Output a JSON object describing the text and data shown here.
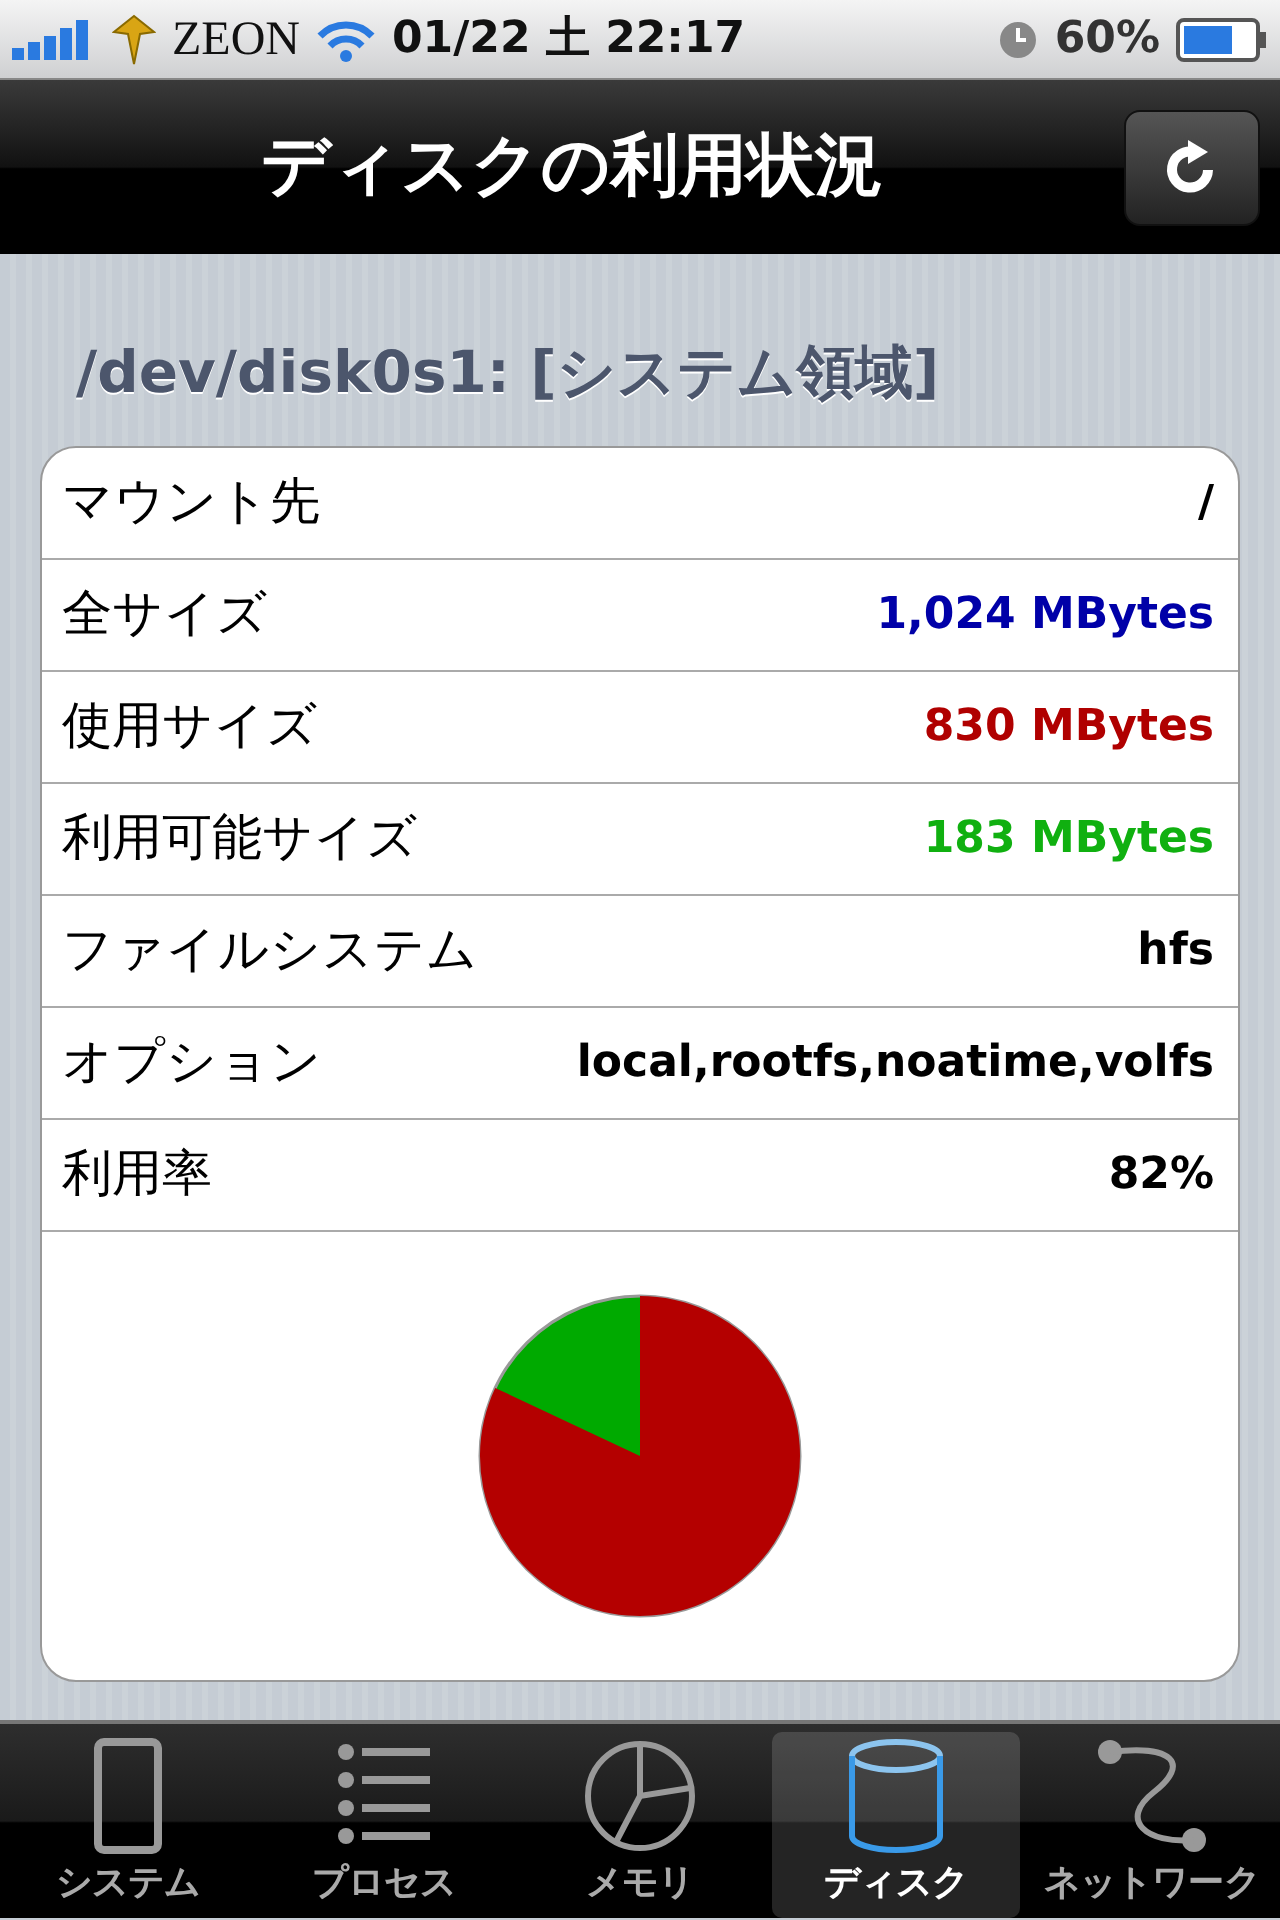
{
  "status_bar": {
    "carrier": "ZEON",
    "datetime": "01/22 土 22:17",
    "battery": "60%"
  },
  "nav_bar": {
    "title": "ディスクの利用状況"
  },
  "section": {
    "title": "/dev/disk0s1: [システム領域]"
  },
  "rows": [
    {
      "label": "マウント先",
      "value": "/",
      "color": "#000000"
    },
    {
      "label": "全サイズ",
      "value": "1,024 MBytes",
      "color": "#0000a8"
    },
    {
      "label": "使用サイズ",
      "value": "830 MBytes",
      "color": "#b00000"
    },
    {
      "label": "利用可能サイズ",
      "value": "183 MBytes",
      "color": "#10b010"
    },
    {
      "label": "ファイルシステム",
      "value": "hfs",
      "color": "#000000"
    },
    {
      "label": "オプション",
      "value": "local,rootfs,noatime,volfs",
      "color": "#000000"
    },
    {
      "label": "利用率",
      "value": "82%",
      "color": "#000000"
    }
  ],
  "tabs": [
    {
      "label": "システム",
      "kind": "device",
      "selected": false
    },
    {
      "label": "プロセス",
      "kind": "list",
      "selected": false
    },
    {
      "label": "メモリ",
      "kind": "pie",
      "selected": false
    },
    {
      "label": "ディスク",
      "kind": "disk",
      "selected": true
    },
    {
      "label": "ネットワーク",
      "kind": "network",
      "selected": false
    }
  ]
}
